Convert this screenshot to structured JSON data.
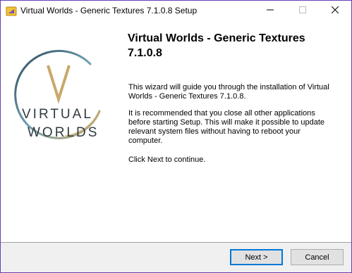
{
  "window": {
    "title": "Virtual Worlds - Generic Textures 7.1.0.8 Setup",
    "border_color": "#6a3fb4"
  },
  "titlebar": {
    "app_icon": "installer-icon",
    "minimize_icon": "minimize-icon",
    "maximize_icon": "maximize-icon",
    "close_icon": "close-icon"
  },
  "logo": {
    "letter": "V",
    "line1": "VIRTUAL",
    "line2": "WORLDS",
    "ring_colors": [
      "#2a4858",
      "#6fa0b3",
      "#c9a86a"
    ]
  },
  "main": {
    "heading": "Virtual Worlds - Generic Textures 7.1.0.8",
    "paragraph1": "This wizard will guide you through the installation of Virtual Worlds - Generic Textures 7.1.0.8.",
    "paragraph2": "It is recommended that you close all other applications before starting Setup. This will make it possible to update relevant system files without having to reboot your computer.",
    "paragraph3": "Click Next to continue."
  },
  "buttons": {
    "next_label": "Next >",
    "cancel_label": "Cancel",
    "focus_color": "#0078d7"
  }
}
